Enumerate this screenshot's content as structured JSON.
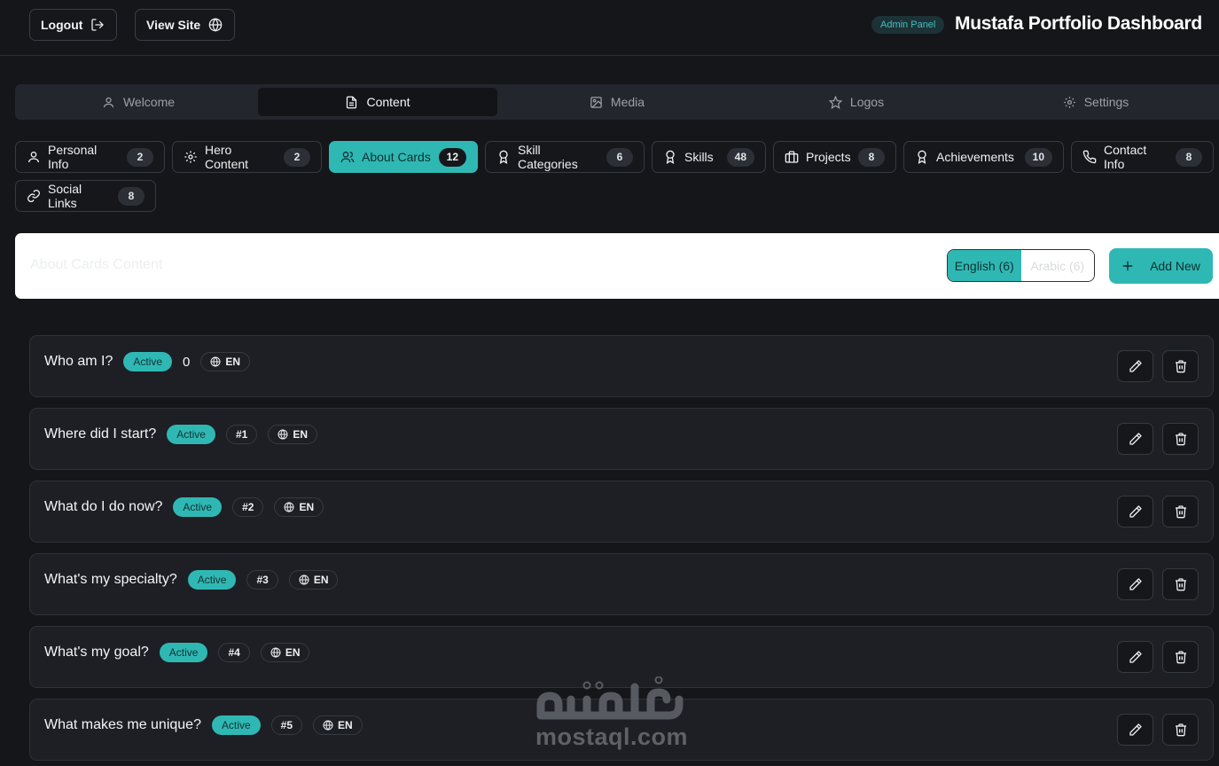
{
  "header": {
    "logout_label": "Logout",
    "view_site_label": "View Site",
    "badge": "Admin Panel",
    "title": "Mustafa Portfolio Dashboard"
  },
  "main_tabs": [
    {
      "label": "Welcome",
      "icon": "user-icon",
      "active": false
    },
    {
      "label": "Content",
      "icon": "file-icon",
      "active": true
    },
    {
      "label": "Media",
      "icon": "image-icon",
      "active": false
    },
    {
      "label": "Logos",
      "icon": "star-icon",
      "active": false
    },
    {
      "label": "Settings",
      "icon": "gear-icon",
      "active": false
    }
  ],
  "sub_tabs": [
    {
      "label": "Personal Info",
      "count": "2",
      "icon": "user-icon"
    },
    {
      "label": "Hero Content",
      "count": "2",
      "icon": "gear-icon"
    },
    {
      "label": "About Cards",
      "count": "12",
      "icon": "users-icon",
      "active": true
    },
    {
      "label": "Skill Categories",
      "count": "6",
      "icon": "award-icon"
    },
    {
      "label": "Skills",
      "count": "48",
      "icon": "award-icon"
    },
    {
      "label": "Projects",
      "count": "8",
      "icon": "briefcase-icon"
    },
    {
      "label": "Achievements",
      "count": "10",
      "icon": "award-icon"
    },
    {
      "label": "Contact Info",
      "count": "8",
      "icon": "phone-icon"
    },
    {
      "label": "Social Links",
      "count": "8",
      "icon": "link-icon"
    }
  ],
  "panel": {
    "title": "About Cards Content",
    "lang_english": "English (6)",
    "lang_arabic": "Arabic (6)",
    "add_label": "Add New"
  },
  "cards": [
    {
      "title": "Who am I?",
      "status": "Active",
      "order": "0",
      "lang": "EN"
    },
    {
      "title": "Where did I start?",
      "status": "Active",
      "order": "#1",
      "lang": "EN"
    },
    {
      "title": "What do I do now?",
      "status": "Active",
      "order": "#2",
      "lang": "EN"
    },
    {
      "title": "What's my specialty?",
      "status": "Active",
      "order": "#3",
      "lang": "EN"
    },
    {
      "title": "What's my goal?",
      "status": "Active",
      "order": "#4",
      "lang": "EN"
    },
    {
      "title": "What makes me unique?",
      "status": "Active",
      "order": "#5",
      "lang": "EN"
    }
  ],
  "watermark": {
    "text": "mostaql.com",
    "logo": "مستقل"
  },
  "colors": {
    "accent": "#2fb8b3",
    "background": "#14161a",
    "card": "#1d1f24"
  }
}
